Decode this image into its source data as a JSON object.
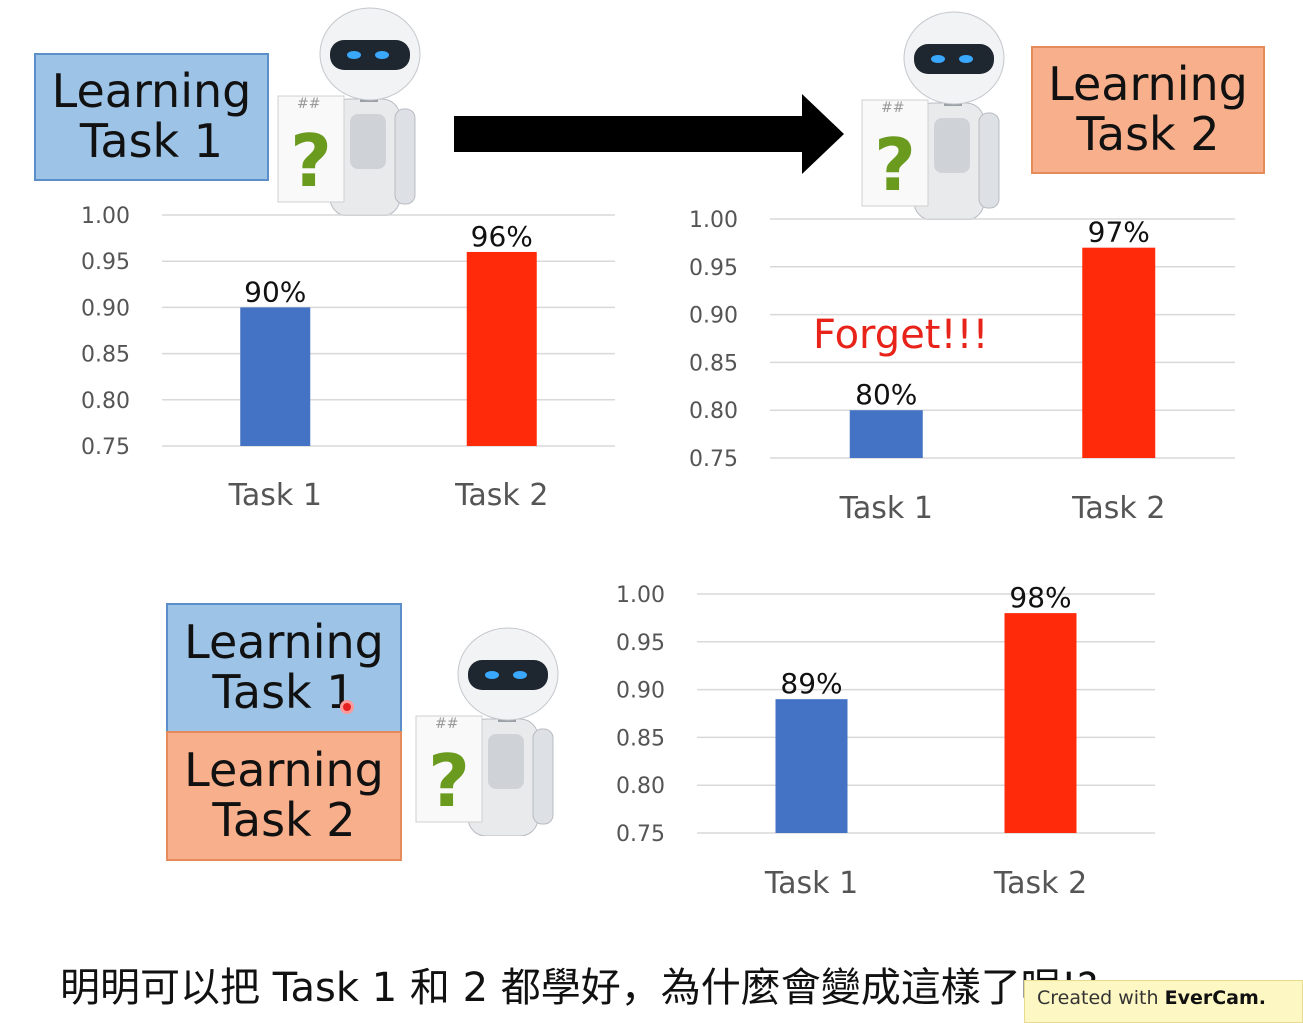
{
  "boxes": {
    "top_left": [
      "Learning",
      "Task 1"
    ],
    "top_right": [
      "Learning",
      "Task 2"
    ],
    "bottom_blue": [
      "Learning",
      "Task 1"
    ],
    "bottom_orange": [
      "Learning",
      "Task 2"
    ]
  },
  "robot_sign": "?",
  "forget_label": "Forget!!!",
  "caption": "明明可以把 Task 1 和 2 都學好，為什麼會變成這樣了呢!?",
  "watermark": {
    "prefix": "Created with ",
    "brand": "EverCam."
  },
  "colors": {
    "task1": "#4472c4",
    "task2": "#ff2a0a",
    "blue_box": "#9dc3e6",
    "orange_box": "#f8b08c",
    "forget": "#e8231a"
  },
  "chart_data": [
    {
      "type": "bar",
      "categories": [
        "Task 1",
        "Task 2"
      ],
      "values": [
        0.9,
        0.96
      ],
      "data_labels": [
        "90%",
        "96%"
      ],
      "yticks": [
        "1.00",
        "0.95",
        "0.90",
        "0.85",
        "0.80",
        "0.75"
      ],
      "ylim": [
        0.75,
        1.0
      ],
      "grid": true
    },
    {
      "type": "bar",
      "categories": [
        "Task 1",
        "Task 2"
      ],
      "values": [
        0.8,
        0.97
      ],
      "data_labels": [
        "80%",
        "97%"
      ],
      "yticks": [
        "1.00",
        "0.95",
        "0.90",
        "0.85",
        "0.80",
        "0.75"
      ],
      "ylim": [
        0.75,
        1.0
      ],
      "grid": true
    },
    {
      "type": "bar",
      "categories": [
        "Task 1",
        "Task 2"
      ],
      "values": [
        0.89,
        0.98
      ],
      "data_labels": [
        "89%",
        "98%"
      ],
      "yticks": [
        "1.00",
        "0.95",
        "0.90",
        "0.85",
        "0.80",
        "0.75"
      ],
      "ylim": [
        0.75,
        1.0
      ],
      "grid": true
    }
  ]
}
